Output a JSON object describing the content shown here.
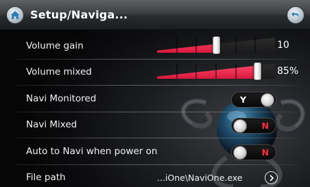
{
  "header": {
    "title": "Setup/Naviga...",
    "home_icon": "home-icon",
    "back_icon": "back-arrow-icon"
  },
  "settings": {
    "volume_gain": {
      "label": "Volume gain",
      "value_text": "10",
      "level": 0.5
    },
    "volume_mixed": {
      "label": "Volume mixed",
      "value_text": "85%",
      "level": 0.85
    },
    "navi_monitored": {
      "label": "Navi Monitored",
      "state": "Y"
    },
    "navi_mixed": {
      "label": "Navi Mixed",
      "state": "N"
    },
    "auto_to_navi": {
      "label": "Auto to Navi when power on",
      "state": "N"
    },
    "file_path": {
      "label": "File path",
      "value": "...iOne\\NaviOne.exe",
      "icon": "chevron-right-circle-icon"
    }
  },
  "colors": {
    "slider_fill": "#e8203f",
    "off_state": "#ff2d3a",
    "on_state": "#ffffff"
  }
}
